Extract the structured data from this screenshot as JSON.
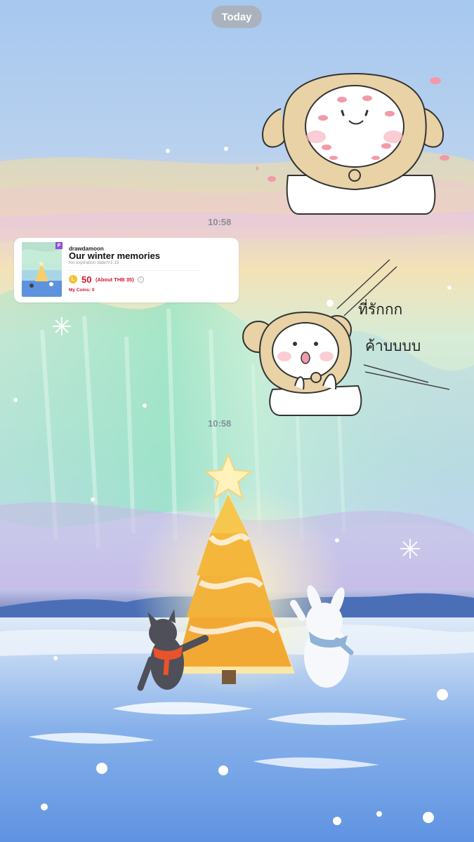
{
  "chat": {
    "date_label": "Today",
    "timestamps": [
      "10:58",
      "10:58"
    ]
  },
  "product_card": {
    "creator": "drawdamoon",
    "title": "Our winter memories",
    "expiry": "No expiration date/V1.15",
    "badge": "P",
    "price": "50",
    "price_about": "(About THB 35)",
    "my_coins": "My Coins: 0",
    "coin_icon_letter": "L",
    "info_icon_glyph": "i"
  },
  "stickers": {
    "second_text_line1": "ที่รักกก",
    "second_text_line2": "ค้าบบบบ"
  },
  "colors": {
    "price_red": "#d2162c",
    "coin_gold": "#f2c12e",
    "premium_purple": "#8e4fd6"
  }
}
